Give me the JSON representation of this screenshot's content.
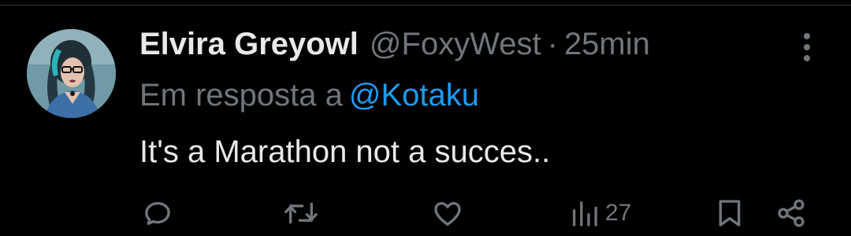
{
  "tweet": {
    "display_name": "Elvira Greyowl",
    "handle": "@FoxyWest",
    "separator": "·",
    "timestamp": "25min",
    "reply_prefix": "Em resposta a",
    "reply_to": "@Kotaku",
    "text": "It's a Marathon not a succes.."
  },
  "actions": {
    "reply_icon": "reply-icon",
    "retweet_icon": "retweet-icon",
    "like_icon": "heart-icon",
    "views_icon": "views-chart-icon",
    "views_count": "27",
    "bookmark_icon": "bookmark-icon",
    "share_icon": "share-icon"
  },
  "colors": {
    "background": "#000000",
    "primary_text": "#e7e9ea",
    "secondary_text": "#71767b",
    "link": "#1d9bf0",
    "icon": "#71767b"
  }
}
